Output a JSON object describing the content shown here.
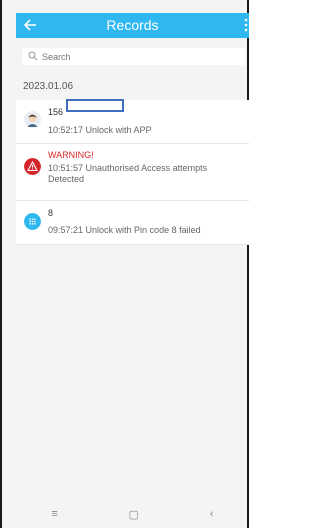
{
  "header": {
    "title": "Records"
  },
  "search": {
    "placeholder": "Search"
  },
  "date_group": "2023.01.06",
  "records": [
    {
      "title": "156",
      "detail": "10:52:17 Unlock with APP",
      "icon": "user-avatar-icon"
    },
    {
      "title": "WARNING!",
      "detail": "10:51:57 Unauthorised Access attempts Detected",
      "icon": "warning-triangle-icon",
      "color": "#d6262a"
    },
    {
      "title": "8",
      "detail": "09:57:21 Unlock with Pin code 8 failed",
      "icon": "keypad-icon",
      "color": "#2fb8ef"
    }
  ],
  "navbar": {
    "menu": "≡",
    "home": "▢",
    "back": "‹"
  }
}
